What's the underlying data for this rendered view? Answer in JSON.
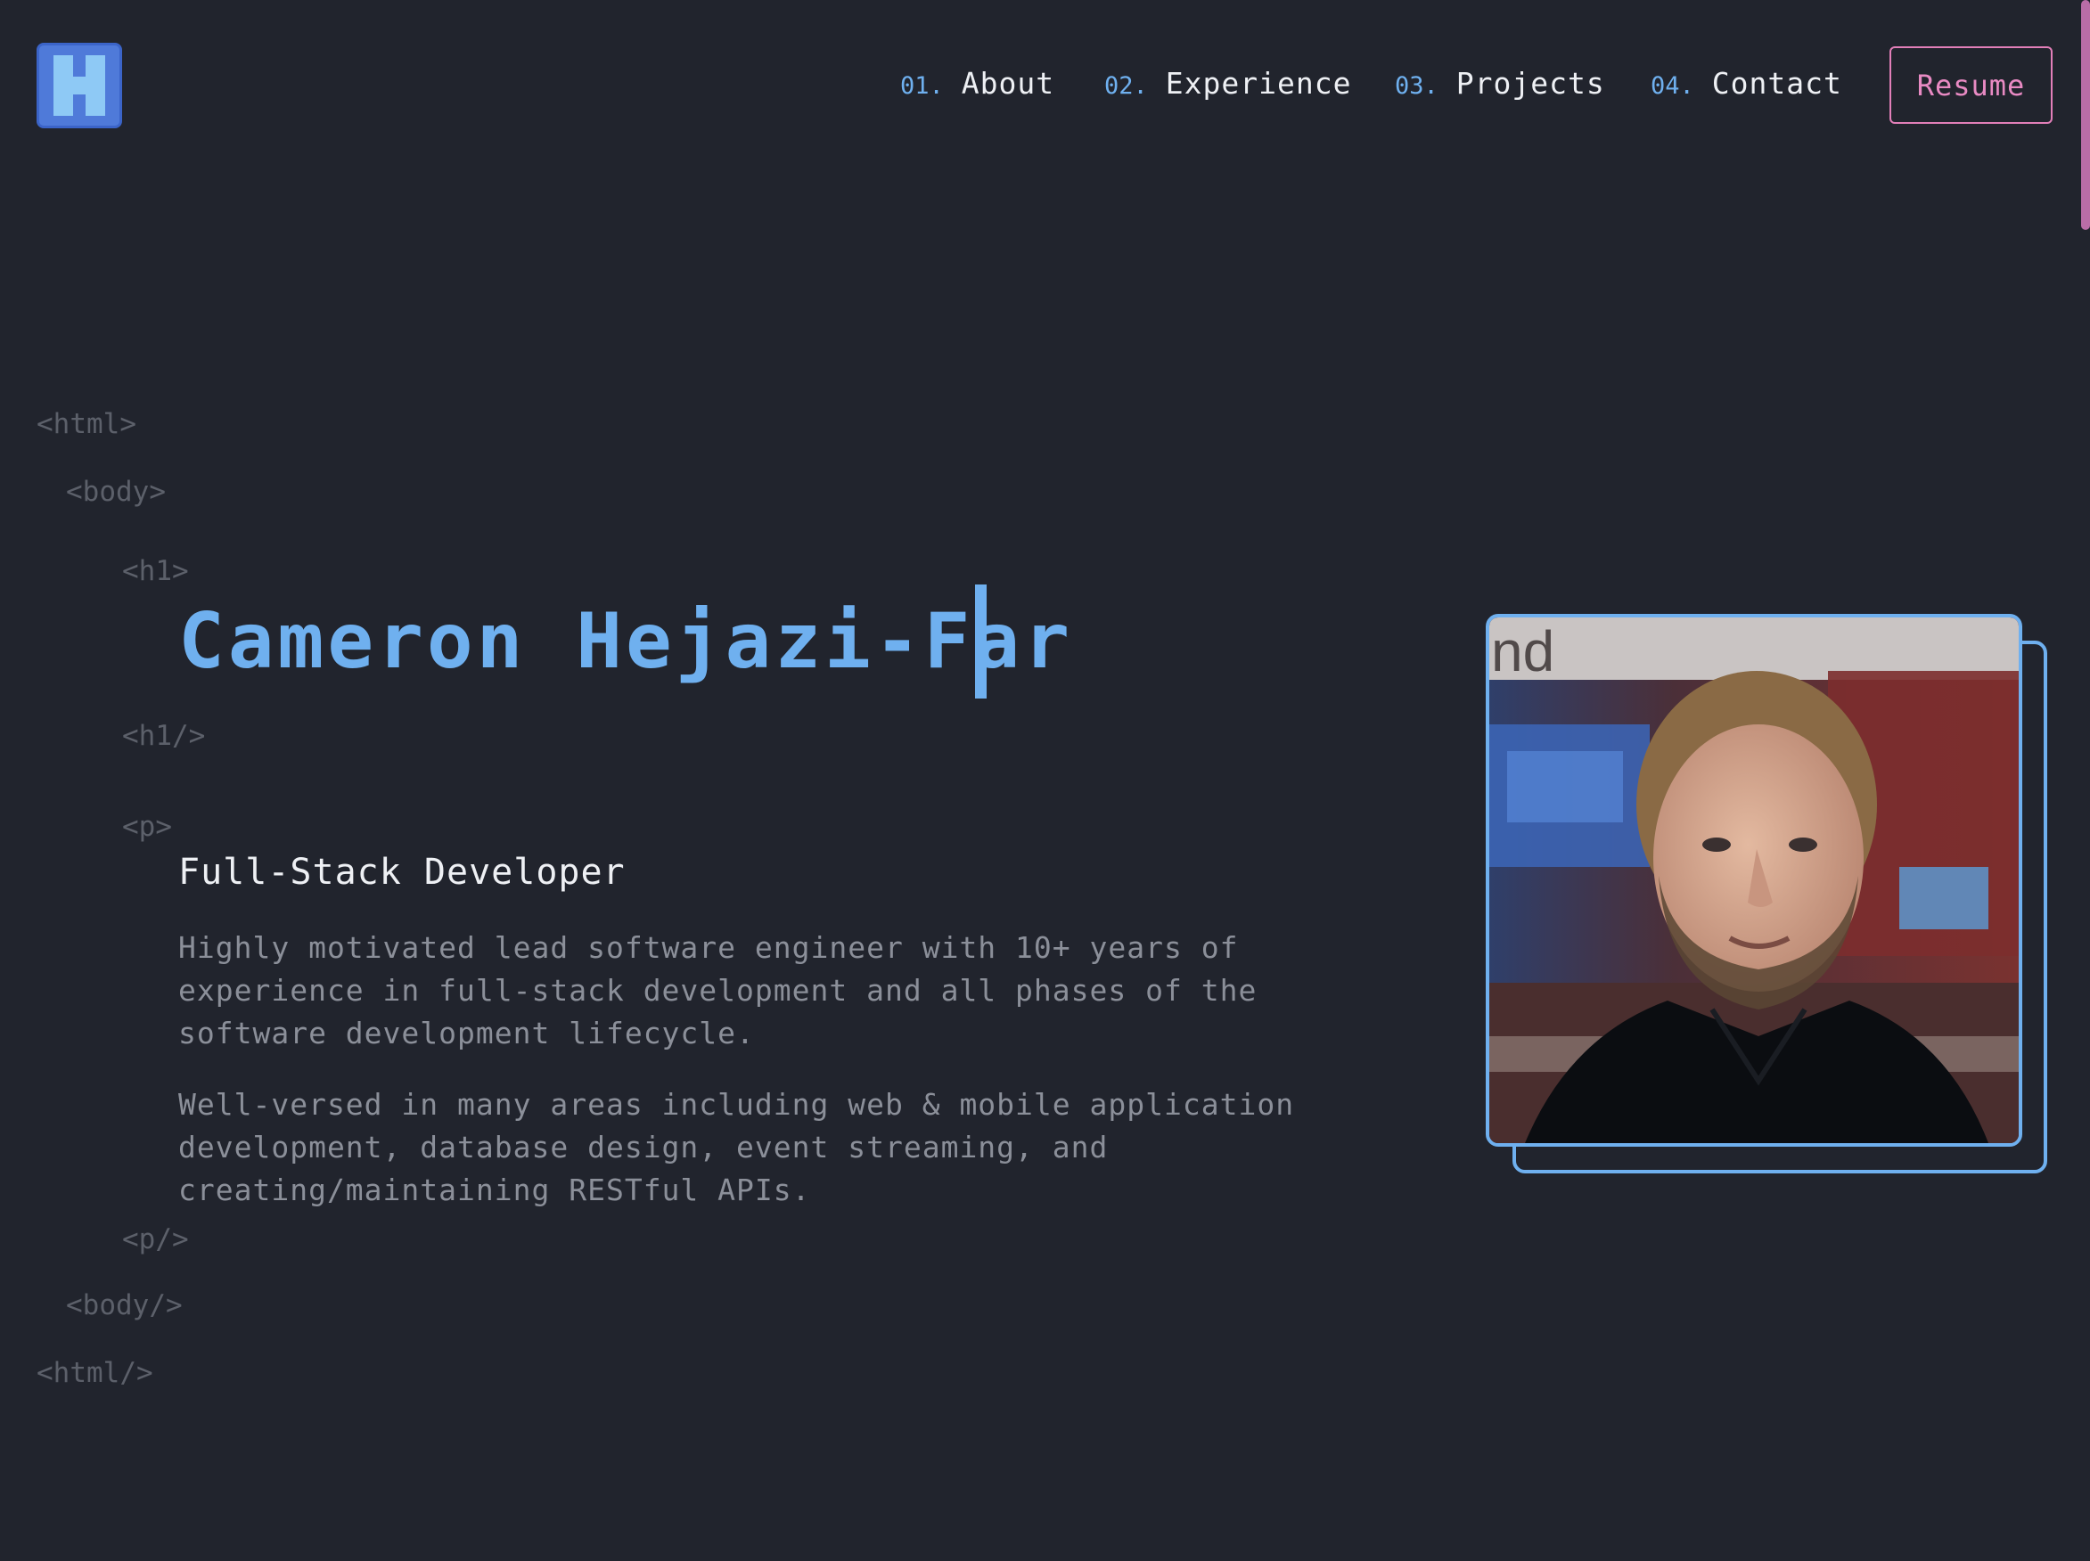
{
  "header": {
    "logo_letter": "H",
    "nav": [
      {
        "num": "01.",
        "label": "About"
      },
      {
        "num": "02.",
        "label": "Experience"
      },
      {
        "num": "03.",
        "label": "Projects"
      },
      {
        "num": "04.",
        "label": "Contact"
      }
    ],
    "resume_label": "Resume"
  },
  "hero": {
    "tags": {
      "html_open": "<html>",
      "body_open": "<body>",
      "h1_open": "<h1>",
      "h1_close": "<h1/>",
      "p_open": "<p>",
      "p_close": "<p/>",
      "body_close": "<body/>",
      "html_close": "<html/>"
    },
    "name": "Cameron Hejazi-Far",
    "role": "Full-Stack Developer",
    "paragraphs": [
      "Highly motivated lead software engineer with 10+ years of experience in full-stack development and all phases of the software development lifecycle.",
      "Well-versed in many areas including web & mobile application development, database design, event streaming, and creating/maintaining RESTful APIs."
    ],
    "photo_background_text": "nd"
  },
  "colors": {
    "background": "#21242d",
    "accent_blue": "#6fb0ef",
    "accent_pink": "#e27fb9",
    "logo_blue": "#4f7ad9",
    "tag_gray": "#5c606a",
    "body_gray": "#8b8f99",
    "heading_white": "#eef0f4"
  }
}
